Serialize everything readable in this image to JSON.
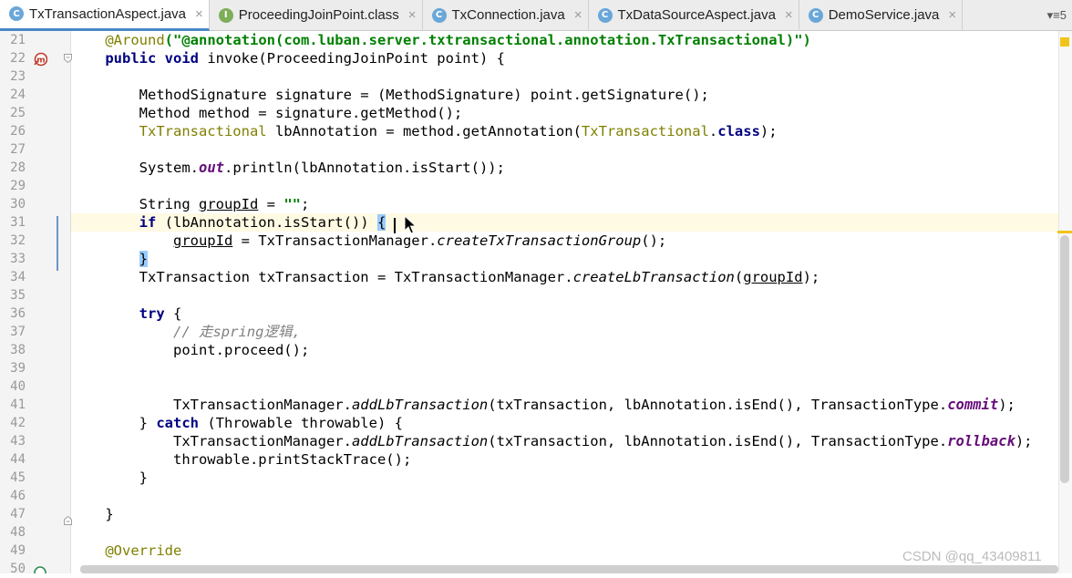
{
  "tabs": [
    {
      "icon": "class-icon",
      "glyph": "C",
      "label": "TxTransactionAspect.java",
      "close": "×"
    },
    {
      "icon": "interface-icon",
      "glyph": "I",
      "label": "ProceedingJoinPoint.class",
      "close": "×"
    },
    {
      "icon": "class-icon",
      "glyph": "C",
      "label": "TxConnection.java",
      "close": "×"
    },
    {
      "icon": "class-icon",
      "glyph": "C",
      "label": "TxDataSourceAspect.java",
      "close": "×"
    },
    {
      "icon": "class-icon",
      "glyph": "C",
      "label": "DemoService.java",
      "close": "×"
    }
  ],
  "tab_overflow": "▾≡5",
  "line_numbers": [
    "21",
    "22",
    "23",
    "24",
    "25",
    "26",
    "27",
    "28",
    "29",
    "30",
    "31",
    "32",
    "33",
    "34",
    "35",
    "36",
    "37",
    "38",
    "39",
    "40",
    "41",
    "42",
    "43",
    "44",
    "45",
    "46",
    "47",
    "48",
    "49",
    "50"
  ],
  "code": {
    "l21": {
      "indent": "    ",
      "ann": "@Around",
      "p1": "(\"",
      "meta": "@annotation",
      "p2": "(com.luban.server.txtransactional.annotation.TxTransactional)\")"
    },
    "l22": {
      "indent": "    ",
      "kw1": "public",
      "kw2": "void",
      "rest": " invoke(ProceedingJoinPoint point) {"
    },
    "l24": {
      "text": "        MethodSignature signature = (MethodSignature) point.getSignature();"
    },
    "l25": {
      "text": "        Method method = signature.getMethod();"
    },
    "l26": {
      "indent": "        ",
      "type": "TxTransactional",
      "mid": " lbAnnotation = method.getAnnotation(",
      "type2": "TxTransactional",
      "dot": ".",
      "kw": "class",
      "end": ");"
    },
    "l28": {
      "indent": "        ",
      "pre": "System.",
      "fld": "out",
      "post": ".println(lbAnnotation.isStart());"
    },
    "l30": {
      "indent": "        ",
      "pre": "String ",
      "var": "groupId",
      "mid": " = ",
      "str": "\"\"",
      "end": ";"
    },
    "l31": {
      "indent": "        ",
      "kw": "if",
      "mid": " (lbAnnotation.isStart()) ",
      "brace": "{"
    },
    "l32": {
      "indent": "            ",
      "var": "groupId",
      "mid": " = TxTransactionManager.",
      "method": "createTxTransactionGroup",
      "end": "();"
    },
    "l33": {
      "indent": "        ",
      "brace": "}"
    },
    "l34": {
      "indent": "        ",
      "pre": "TxTransaction txTransaction = TxTransactionManager.",
      "method": "createLbTransaction",
      "mid": "(",
      "var": "groupId",
      "end": ");"
    },
    "l36": {
      "indent": "        ",
      "kw": "try",
      "end": " {"
    },
    "l37": {
      "indent": "            ",
      "comment": "// 走spring逻辑,"
    },
    "l38": {
      "text": "            point.proceed();"
    },
    "l41": {
      "indent": "            ",
      "pre": "TxTransactionManager.",
      "method": "addLbTransaction",
      "mid": "(txTransaction, lbAnnotation.isEnd(), TransactionType.",
      "fld": "commit",
      "end": ");"
    },
    "l42": {
      "indent": "        ",
      "pre": "} ",
      "kw": "catch",
      "end": " (Throwable throwable) {"
    },
    "l43": {
      "indent": "            ",
      "pre": "TxTransactionManager.",
      "method": "addLbTransaction",
      "mid": "(txTransaction, lbAnnotation.isEnd(), TransactionType.",
      "fld": "rollback",
      "end": ");"
    },
    "l44": {
      "text": "            throwable.printStackTrace();"
    },
    "l45": {
      "text": "        }"
    },
    "l47": {
      "text": "    }"
    },
    "l49": {
      "indent": "    ",
      "ann": "@Override"
    }
  },
  "watermark": "CSDN @qq_43409811",
  "colors": {
    "keyword": "#000080",
    "annotation": "#808000",
    "string": "#008000",
    "comment": "#808080",
    "static_field": "#660e7a",
    "current_line": "#fffae3",
    "brace_match": "#99ccff",
    "active_tab_underline": "#4a86c8"
  }
}
